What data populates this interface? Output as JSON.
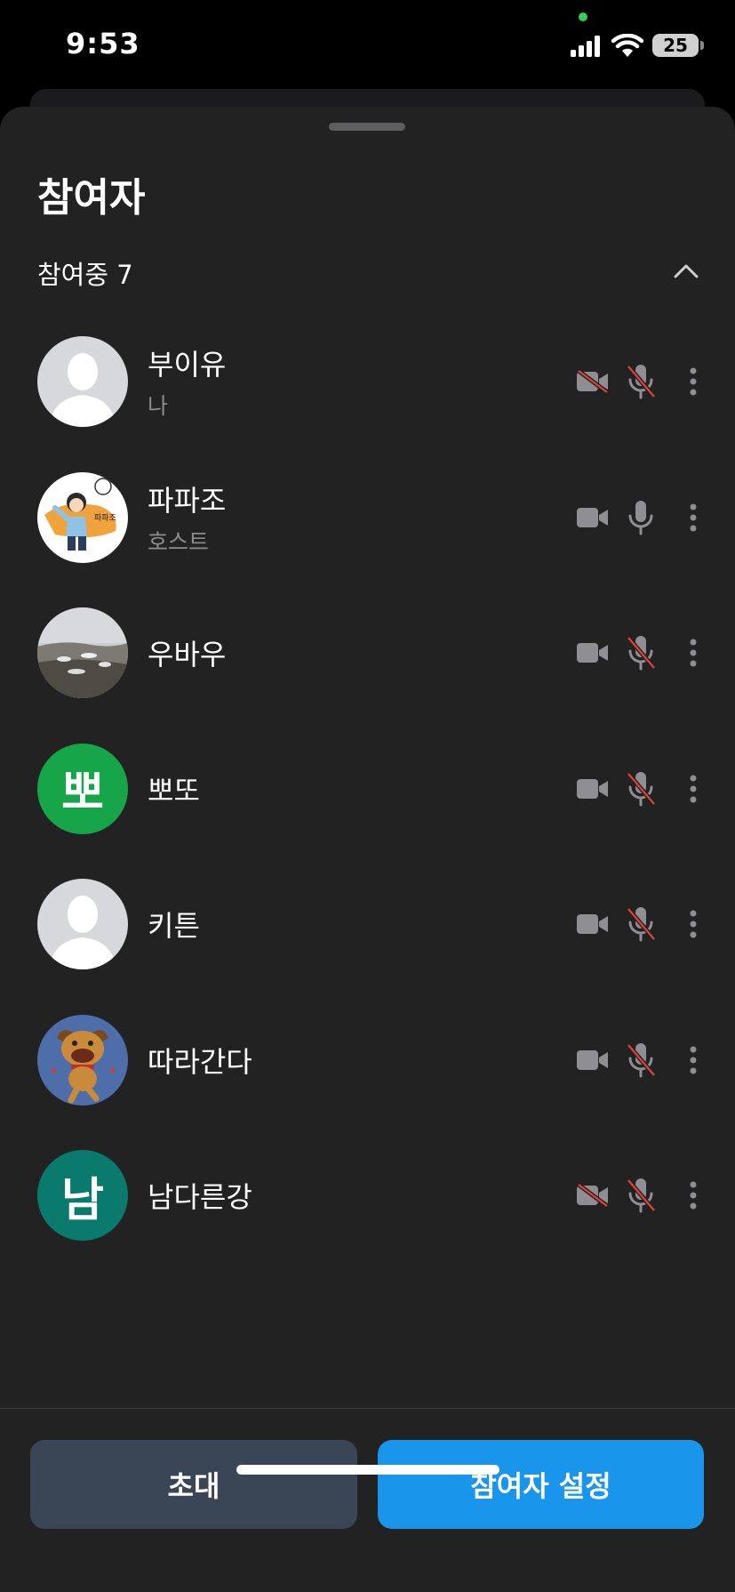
{
  "status_bar": {
    "time": "9:53",
    "battery": "25"
  },
  "sheet": {
    "title": "참여자",
    "section_label": "참여중 7"
  },
  "participants": [
    {
      "name": "부이유",
      "sub": "나",
      "avatar": "default-person",
      "video_off": true,
      "mic_muted": true
    },
    {
      "name": "파파조",
      "sub": "호스트",
      "avatar": "cartoon-character",
      "video_off": false,
      "mic_muted": false
    },
    {
      "name": "우바우",
      "sub": "",
      "avatar": "landscape-photo",
      "video_off": false,
      "mic_muted": true
    },
    {
      "name": "뽀또",
      "sub": "",
      "avatar": "letter",
      "avatar_letter": "뽀",
      "avatar_color": "#17a54a",
      "video_off": false,
      "mic_muted": true
    },
    {
      "name": "키튼",
      "sub": "",
      "avatar": "default-person",
      "video_off": false,
      "mic_muted": true
    },
    {
      "name": "따라간다",
      "sub": "",
      "avatar": "dog-character",
      "video_off": false,
      "mic_muted": true
    },
    {
      "name": "남다른강",
      "sub": "",
      "avatar": "letter",
      "avatar_letter": "남",
      "avatar_color": "#0a7a6c",
      "video_off": true,
      "mic_muted": true
    }
  ],
  "buttons": {
    "invite": "초대",
    "settings": "참여자 설정"
  },
  "colors": {
    "accent": "#1a95ec",
    "mute_red": "#e0403a",
    "sheet_bg": "#222223"
  }
}
